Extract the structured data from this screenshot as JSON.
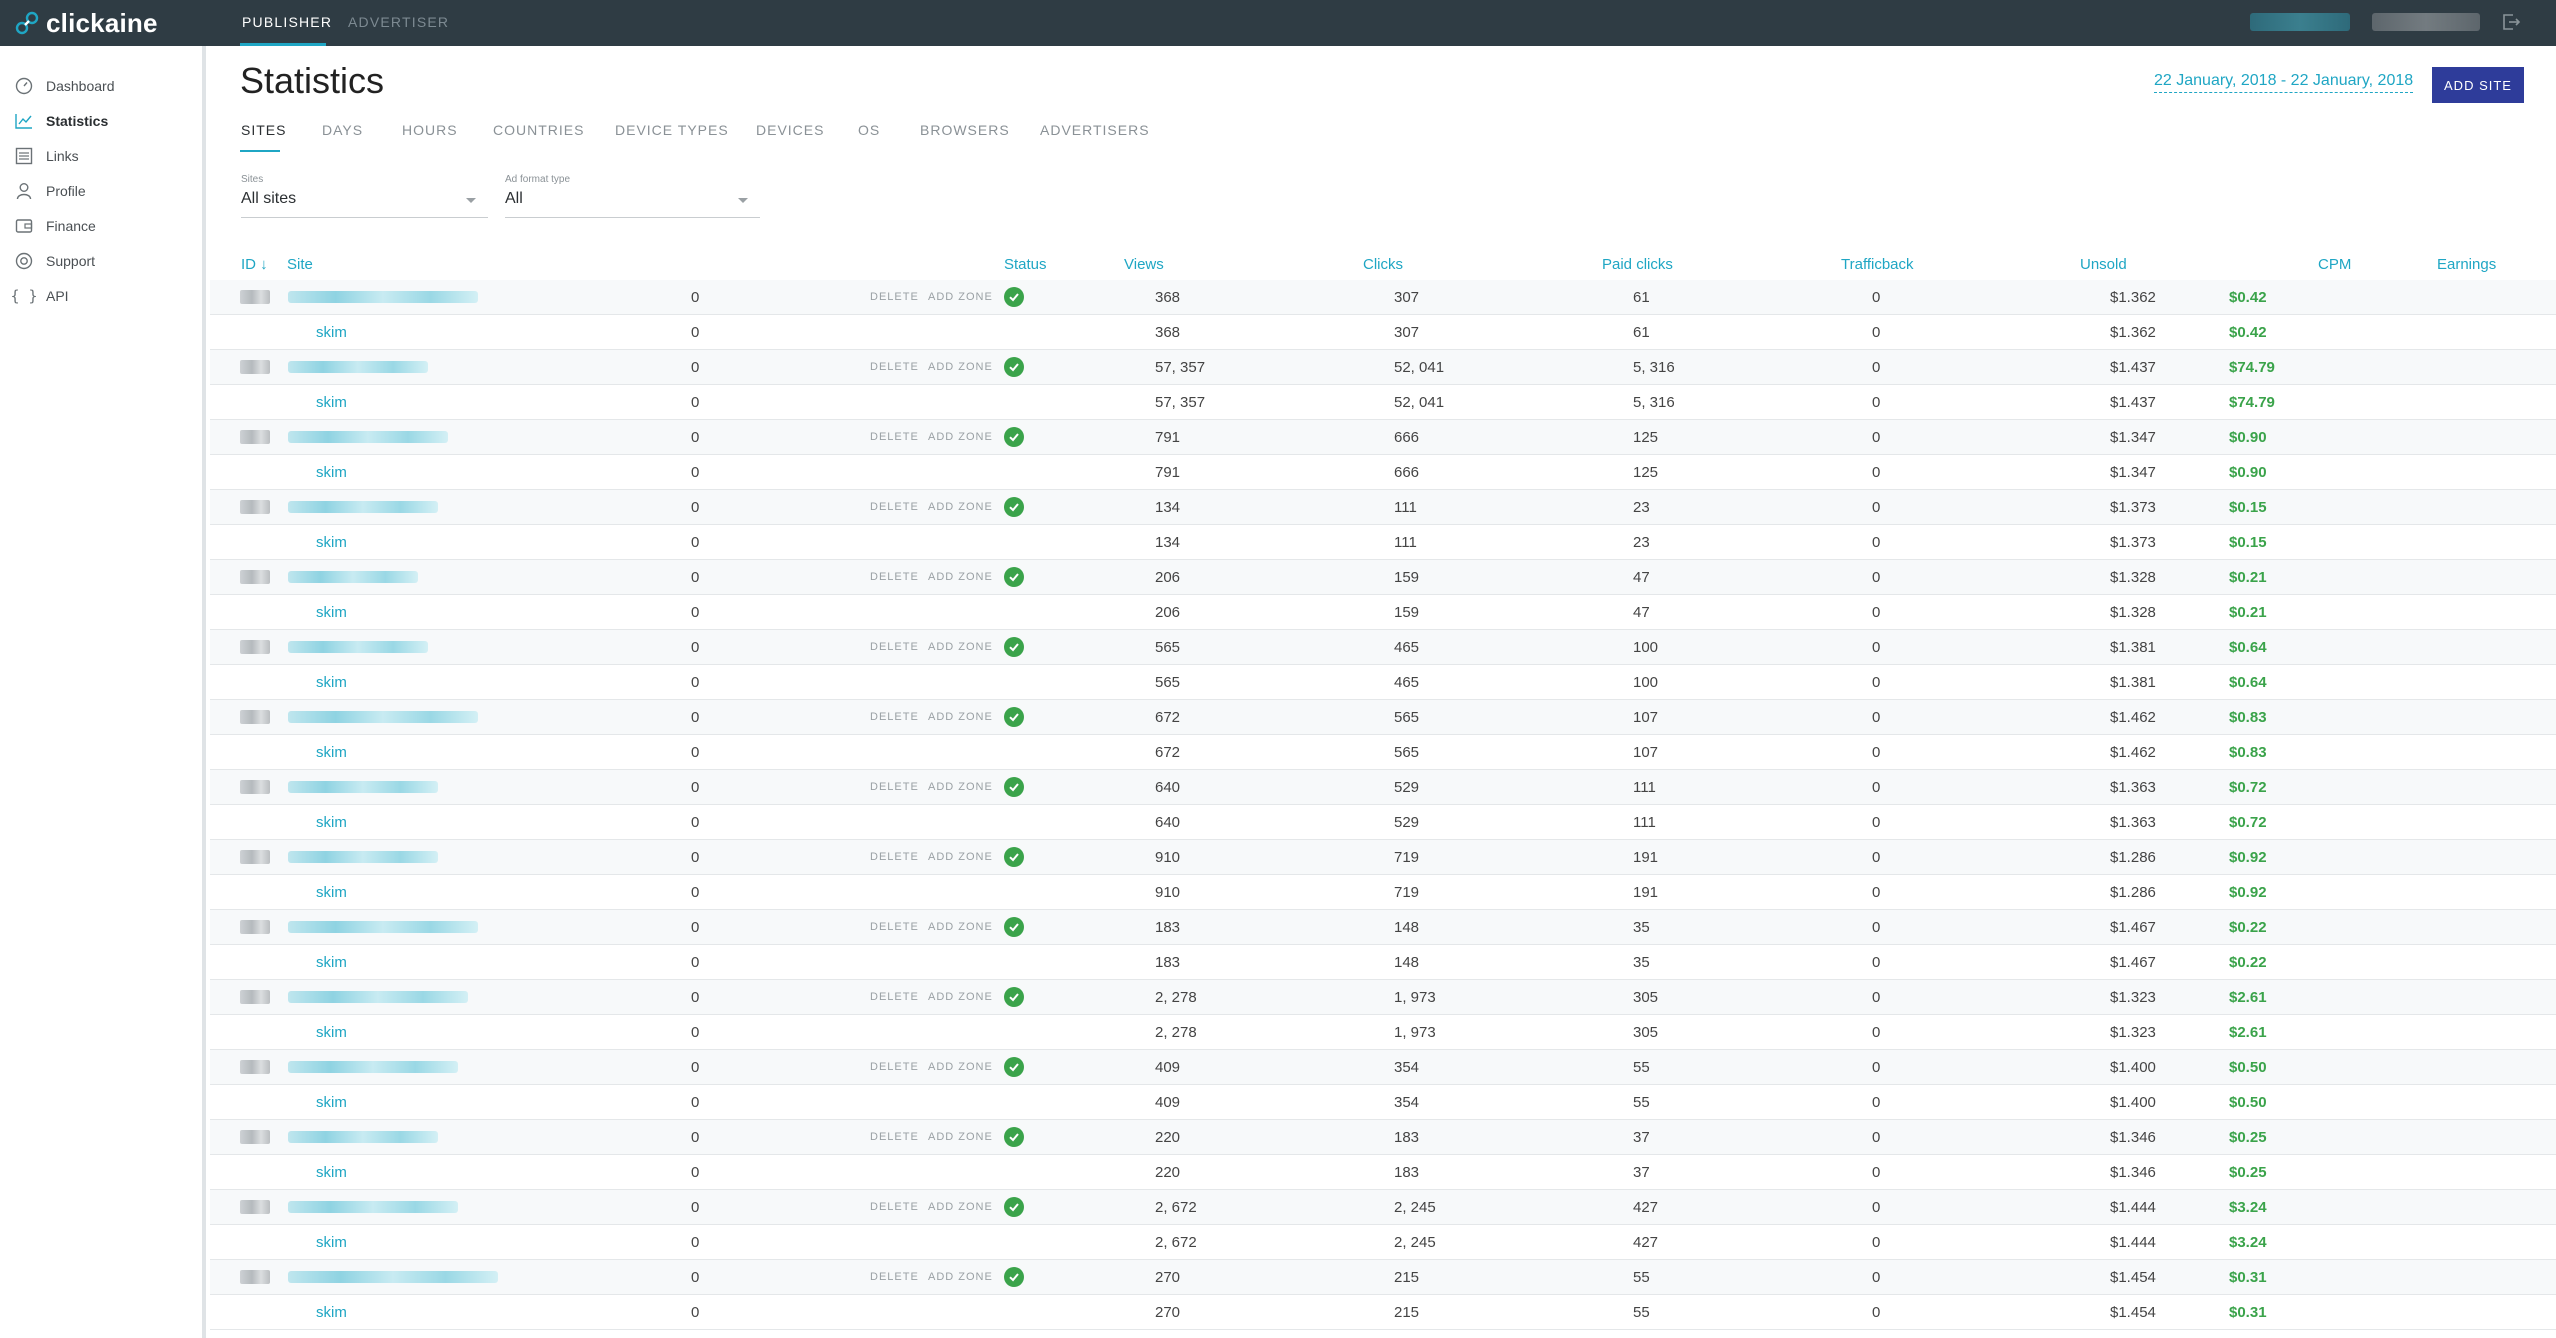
{
  "brand": {
    "name": "clickaine"
  },
  "topnav": {
    "publisher": "PUBLISHER",
    "advertiser": "ADVERTISER"
  },
  "sidebar": {
    "items": [
      {
        "label": "Dashboard",
        "icon": "dashboard-icon"
      },
      {
        "label": "Statistics",
        "icon": "chart-icon"
      },
      {
        "label": "Links",
        "icon": "links-icon"
      },
      {
        "label": "Profile",
        "icon": "user-icon"
      },
      {
        "label": "Finance",
        "icon": "wallet-icon"
      },
      {
        "label": "Support",
        "icon": "support-icon"
      },
      {
        "label": "API",
        "icon": "braces-icon"
      }
    ]
  },
  "page": {
    "title": "Statistics",
    "date_range": "22 January, 2018 - 22 January, 2018",
    "add_site": "ADD SITE"
  },
  "tabs": [
    "SITES",
    "DAYS",
    "HOURS",
    "COUNTRIES",
    "DEVICE TYPES",
    "DEVICES",
    "OS",
    "BROWSERS",
    "ADVERTISERS"
  ],
  "filters": {
    "sites": {
      "label": "Sites",
      "value": "All sites"
    },
    "ad_format": {
      "label": "Ad format type",
      "value": "All"
    }
  },
  "table": {
    "headers": {
      "id": "ID ↓",
      "site": "Site",
      "status": "Status",
      "views": "Views",
      "clicks": "Clicks",
      "paid": "Paid clicks",
      "traffic": "Trafficback",
      "unsold": "Unsold",
      "cpm": "CPM",
      "earnings": "Earnings"
    },
    "delete_label": "DELETE",
    "add_zone_label": "ADD ZONE",
    "zone_name": "skim",
    "rows": [
      {
        "views": "0",
        "clicks": "368",
        "paid": "307",
        "traffic": "61",
        "unsold": "0",
        "cpm": "$1.362",
        "earnings": "$0.42"
      },
      {
        "views": "0",
        "clicks": "57, 357",
        "paid": "52, 041",
        "traffic": "5, 316",
        "unsold": "0",
        "cpm": "$1.437",
        "earnings": "$74.79"
      },
      {
        "views": "0",
        "clicks": "791",
        "paid": "666",
        "traffic": "125",
        "unsold": "0",
        "cpm": "$1.347",
        "earnings": "$0.90"
      },
      {
        "views": "0",
        "clicks": "134",
        "paid": "111",
        "traffic": "23",
        "unsold": "0",
        "cpm": "$1.373",
        "earnings": "$0.15"
      },
      {
        "views": "0",
        "clicks": "206",
        "paid": "159",
        "traffic": "47",
        "unsold": "0",
        "cpm": "$1.328",
        "earnings": "$0.21"
      },
      {
        "views": "0",
        "clicks": "565",
        "paid": "465",
        "traffic": "100",
        "unsold": "0",
        "cpm": "$1.381",
        "earnings": "$0.64"
      },
      {
        "views": "0",
        "clicks": "672",
        "paid": "565",
        "traffic": "107",
        "unsold": "0",
        "cpm": "$1.462",
        "earnings": "$0.83"
      },
      {
        "views": "0",
        "clicks": "640",
        "paid": "529",
        "traffic": "111",
        "unsold": "0",
        "cpm": "$1.363",
        "earnings": "$0.72"
      },
      {
        "views": "0",
        "clicks": "910",
        "paid": "719",
        "traffic": "191",
        "unsold": "0",
        "cpm": "$1.286",
        "earnings": "$0.92"
      },
      {
        "views": "0",
        "clicks": "183",
        "paid": "148",
        "traffic": "35",
        "unsold": "0",
        "cpm": "$1.467",
        "earnings": "$0.22"
      },
      {
        "views": "0",
        "clicks": "2, 278",
        "paid": "1, 973",
        "traffic": "305",
        "unsold": "0",
        "cpm": "$1.323",
        "earnings": "$2.61"
      },
      {
        "views": "0",
        "clicks": "409",
        "paid": "354",
        "traffic": "55",
        "unsold": "0",
        "cpm": "$1.400",
        "earnings": "$0.50"
      },
      {
        "views": "0",
        "clicks": "220",
        "paid": "183",
        "traffic": "37",
        "unsold": "0",
        "cpm": "$1.346",
        "earnings": "$0.25"
      },
      {
        "views": "0",
        "clicks": "2, 672",
        "paid": "2, 245",
        "traffic": "427",
        "unsold": "0",
        "cpm": "$1.444",
        "earnings": "$3.24"
      },
      {
        "views": "0",
        "clicks": "270",
        "paid": "215",
        "traffic": "55",
        "unsold": "0",
        "cpm": "$1.454",
        "earnings": "$0.31"
      }
    ]
  },
  "colors": {
    "accent": "#1fa6c4",
    "topbar": "#2f3c44",
    "button": "#2e3c9a",
    "earnings": "#3aa34a"
  }
}
